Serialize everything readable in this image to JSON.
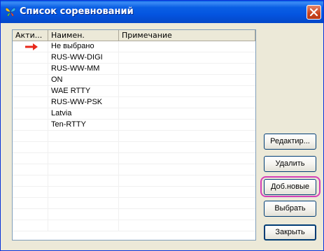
{
  "window": {
    "title": "Список соревнований"
  },
  "columns": [
    "Акти...",
    "Наимен.",
    "Примечание"
  ],
  "rows": [
    {
      "active": true,
      "name": "Не выбрано",
      "note": ""
    },
    {
      "active": false,
      "name": "RUS-WW-DIGI",
      "note": ""
    },
    {
      "active": false,
      "name": "RUS-WW-MM",
      "note": ""
    },
    {
      "active": false,
      "name": "ON",
      "note": ""
    },
    {
      "active": false,
      "name": "WAE RTTY",
      "note": ""
    },
    {
      "active": false,
      "name": "RUS-WW-PSK",
      "note": ""
    },
    {
      "active": false,
      "name": "Latvia",
      "note": ""
    },
    {
      "active": false,
      "name": "Ten-RTTY",
      "note": ""
    }
  ],
  "empty_rows": 9,
  "buttons": {
    "edit": "Редактир...",
    "delete": "Удалить",
    "add_new": "Доб.новые",
    "select": "Выбрать",
    "close": "Закрыть"
  },
  "colors": {
    "title_bar": "#0a5fe4",
    "active_arrow": "#e8281a",
    "highlight": "#d53fb8"
  },
  "icons": {
    "app": "butterfly-icon",
    "close": "close-icon",
    "active_marker": "right-arrow-icon"
  }
}
